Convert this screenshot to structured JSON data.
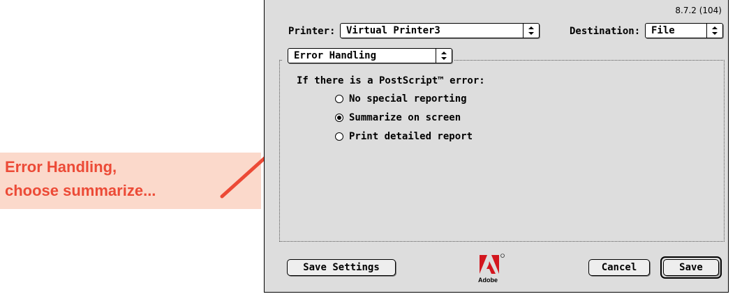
{
  "annotation": {
    "line1": "Error Handling,",
    "line2": "choose summarize...",
    "color": "#ec4a36",
    "background": "#fbd9cb"
  },
  "dialog": {
    "version": "8.7.2 (104)",
    "printer_label": "Printer:",
    "printer_value": "Virtual Printer3",
    "destination_label": "Destination:",
    "destination_value": "File",
    "section_value": "Error Handling",
    "question": "If there is a PostScript™ error:",
    "options": [
      {
        "label": "No special reporting",
        "selected": false
      },
      {
        "label": "Summarize on screen",
        "selected": true
      },
      {
        "label": "Print detailed report",
        "selected": false
      }
    ],
    "save_settings_label": "Save Settings",
    "cancel_label": "Cancel",
    "save_label": "Save",
    "logo_text": "Adobe"
  }
}
